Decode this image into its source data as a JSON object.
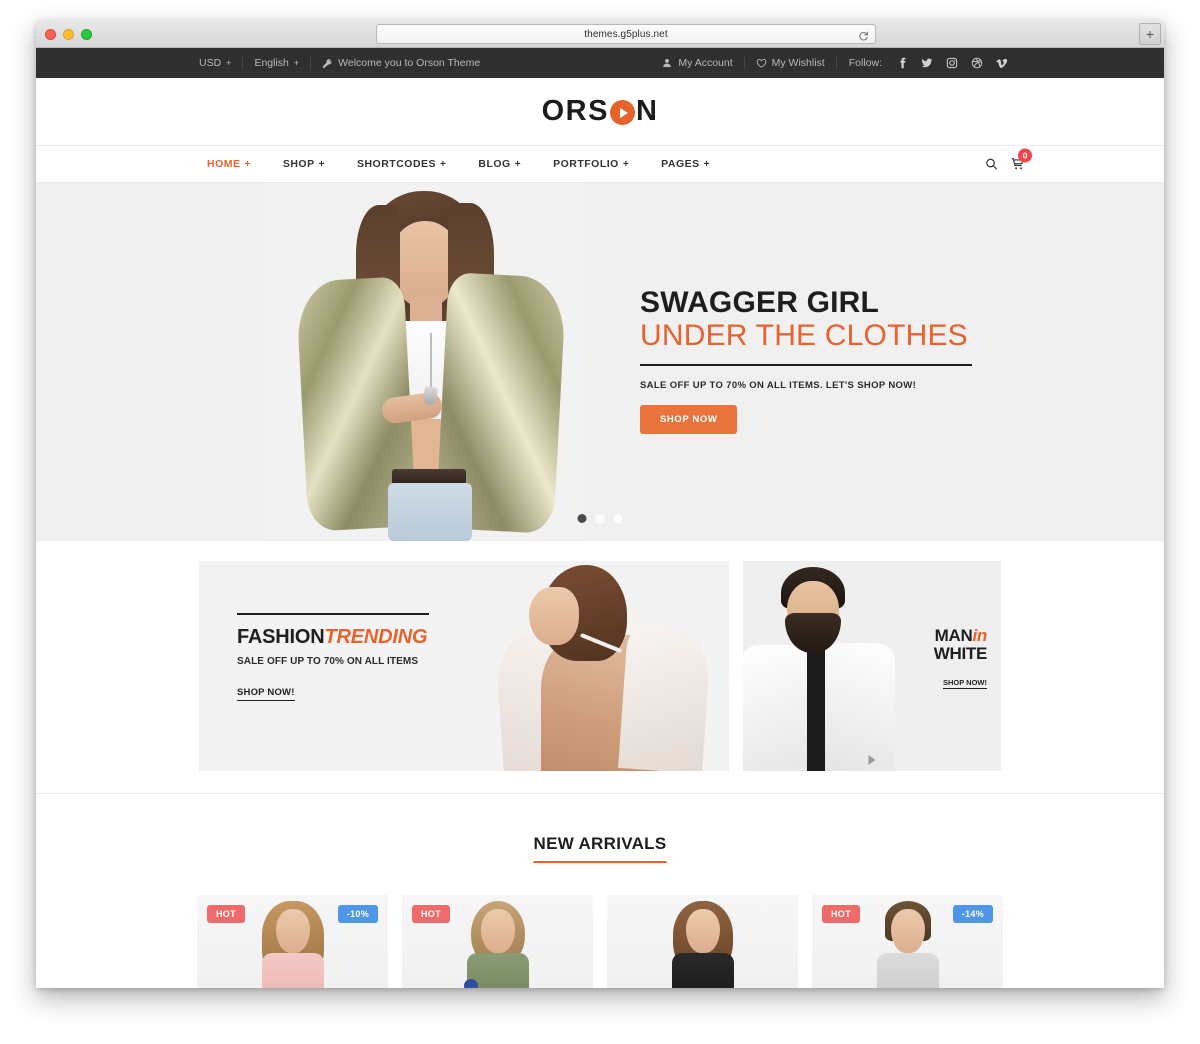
{
  "browser": {
    "url": "themes.g5plus.net",
    "reload_icon": "reload-icon",
    "new_tab_label": "+",
    "traffic_lights": [
      "close",
      "minimize",
      "zoom"
    ]
  },
  "topbar": {
    "currency": "USD",
    "currency_caret": "+",
    "language": "English",
    "language_caret": "+",
    "welcome_icon": "key-icon",
    "welcome": "Welcome you to Orson Theme",
    "account_icon": "user-icon",
    "account": "My Account",
    "wishlist_icon": "heart-icon",
    "wishlist": "My Wishlist",
    "follow_label": "Follow:",
    "social": [
      {
        "name": "facebook-icon",
        "glyph": "f"
      },
      {
        "name": "twitter-icon",
        "glyph": "t"
      },
      {
        "name": "instagram-icon",
        "glyph": "i"
      },
      {
        "name": "dribbble-icon",
        "glyph": "d"
      },
      {
        "name": "vimeo-icon",
        "glyph": "v"
      }
    ]
  },
  "logo": {
    "part1": "ORS",
    "part2": "N",
    "mark": "play-circle-icon"
  },
  "nav": {
    "items": [
      {
        "label": "HOME",
        "caret": "+",
        "active": true
      },
      {
        "label": "SHOP",
        "caret": "+",
        "active": false
      },
      {
        "label": "SHORTCODES",
        "caret": "+",
        "active": false
      },
      {
        "label": "BLOG",
        "caret": "+",
        "active": false
      },
      {
        "label": "PORTFOLIO",
        "caret": "+",
        "active": false
      },
      {
        "label": "PAGES",
        "caret": "+",
        "active": false
      }
    ],
    "search_icon": "search-icon",
    "cart_icon": "cart-icon",
    "cart_count": "0"
  },
  "hero": {
    "title": "SWAGGER GIRL",
    "subtitle": "UNDER THE CLOTHES",
    "description": "SALE OFF UP TO 70% ON ALL ITEMS. LET'S SHOP NOW!",
    "cta": "SHOP NOW",
    "dots": 3,
    "active_dot": 0
  },
  "banners": {
    "left": {
      "title_main": "FASHION",
      "title_accent": "TRENDING",
      "subtitle": "SALE OFF UP TO 70% ON ALL ITEMS",
      "link": "SHOP NOW!"
    },
    "right": {
      "title_main": "MAN",
      "title_accent": "in",
      "title_line2": "WHITE",
      "link": "SHOP NOW!",
      "play_icon": "play-triangle-icon"
    }
  },
  "arrivals": {
    "title": "NEW ARRIVALS",
    "accent_color": "#e8622c",
    "products": [
      {
        "name": "product-1",
        "hot": "HOT",
        "sale": "-10%"
      },
      {
        "name": "product-2",
        "hot": "HOT",
        "sale": ""
      },
      {
        "name": "product-3",
        "hot": "",
        "sale": ""
      },
      {
        "name": "product-4",
        "hot": "HOT",
        "sale": "-14%"
      }
    ]
  },
  "colors": {
    "brand_orange": "#e8622c",
    "cta_orange": "#e8733c",
    "topbar_dark": "#2f2f2f",
    "badge_hot": "#ef6b6b",
    "badge_sale": "#4f96e8",
    "cart_badge": "#f2464b"
  }
}
